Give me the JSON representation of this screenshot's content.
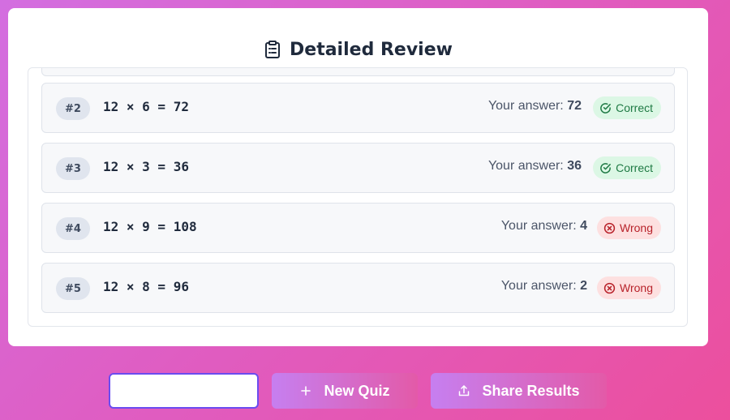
{
  "review": {
    "title": "Detailed Review",
    "title_icon": "clipboard-icon",
    "items": [
      {
        "number": "#2",
        "equation": "12 × 6 = 72",
        "answer_label": "Your answer:",
        "answer": "72",
        "status": "Correct",
        "status_type": "correct"
      },
      {
        "number": "#3",
        "equation": "12 × 3 = 36",
        "answer_label": "Your answer:",
        "answer": "36",
        "status": "Correct",
        "status_type": "correct"
      },
      {
        "number": "#4",
        "equation": "12 × 9 = 108",
        "answer_label": "Your answer:",
        "answer": "4",
        "status": "Wrong",
        "status_type": "wrong"
      },
      {
        "number": "#5",
        "equation": "12 × 8 = 96",
        "answer_label": "Your answer:",
        "answer": "2",
        "status": "Wrong",
        "status_type": "wrong"
      }
    ]
  },
  "actions": {
    "empty_button_label": "",
    "new_quiz_label": "New Quiz",
    "new_quiz_icon": "plus-icon",
    "share_label": "Share Results",
    "share_icon": "share-icon"
  },
  "colors": {
    "correct_bg": "#dcf7e5",
    "correct_text": "#1f7a44",
    "wrong_bg": "#fde0e0",
    "wrong_text": "#b8232b",
    "accent_border": "#6a4cf0"
  }
}
